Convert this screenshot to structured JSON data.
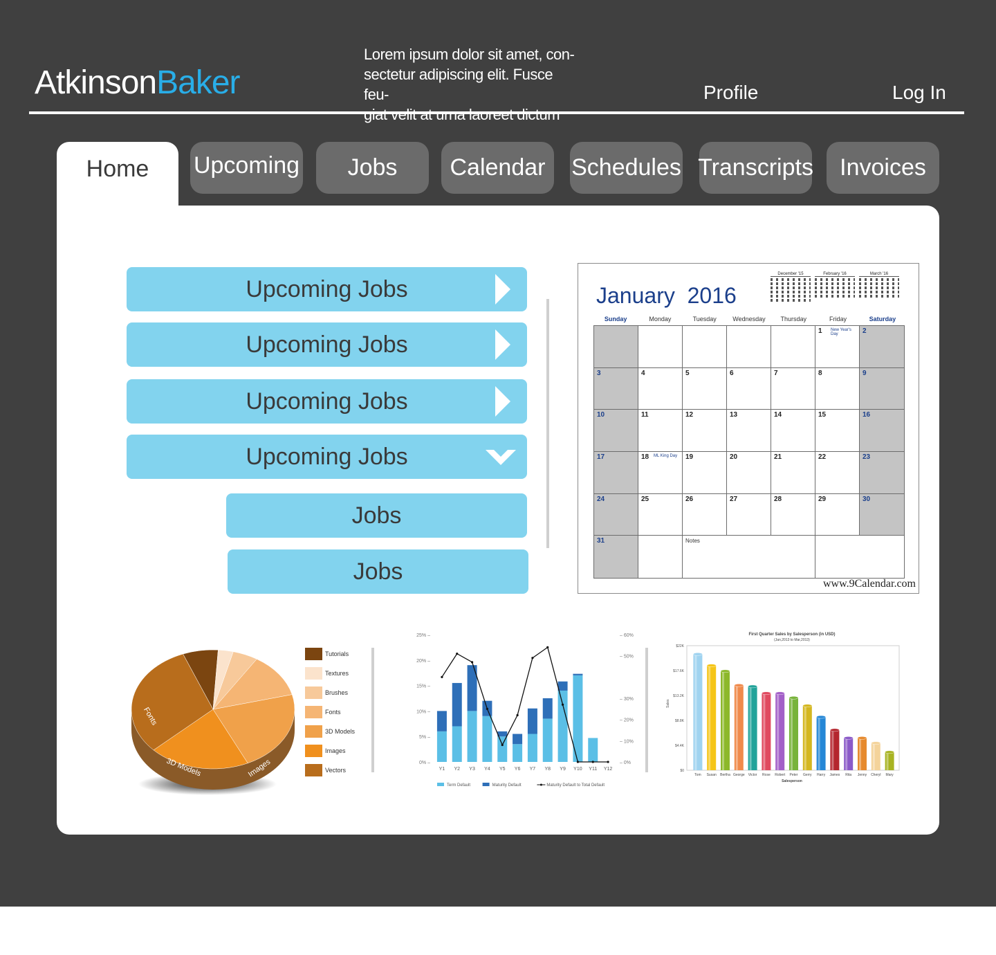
{
  "header": {
    "logo_part1": "Atkinson",
    "logo_part2": "Baker",
    "tagline_line1": "Lorem ipsum dolor sit amet, con-",
    "tagline_line2": "sectetur adipiscing elit. Fusce feu-",
    "tagline_line3": "giat velit at urna laoreet dictum",
    "profile_link": "Profile",
    "login_link": "Log In"
  },
  "tabs": [
    "Home",
    "Upcoming",
    "Jobs",
    "Calendar",
    "Schedules",
    "Transcripts",
    "Invoices"
  ],
  "list": {
    "items": [
      "Upcoming Jobs",
      "Upcoming Jobs",
      "Upcoming Jobs",
      "Upcoming Jobs"
    ],
    "subitems": [
      "Jobs",
      "Jobs"
    ]
  },
  "calendar": {
    "month": "January",
    "year": "2016",
    "mini_months": [
      "December '15",
      "February '16",
      "March '16"
    ],
    "day_names": [
      "Sunday",
      "Monday",
      "Tuesday",
      "Wednesday",
      "Thursday",
      "Friday",
      "Saturday"
    ],
    "holidays": {
      "new_years": "New Year's Day",
      "mlk": "ML King Day"
    },
    "notes_label": "Notes",
    "watermark": "www.9Calendar.com"
  },
  "pie": {
    "legend": [
      "Tutorials",
      "Textures",
      "Brushes",
      "Fonts",
      "3D Models",
      "Images",
      "Vectors"
    ],
    "colors": [
      "#7b4510",
      "#fbe3cc",
      "#f7c99a",
      "#f5b574",
      "#f0a14a",
      "#f0901e",
      "#b86d1c"
    ],
    "values": [
      7,
      3,
      5,
      12,
      22,
      20,
      31
    ],
    "slice_labels": [
      "Fonts",
      "3D Models",
      "Images"
    ]
  },
  "chart_data": [
    {
      "type": "bar",
      "categories": [
        "Y1",
        "Y2",
        "Y3",
        "Y4",
        "Y5",
        "Y6",
        "Y7",
        "Y8",
        "Y9",
        "Y10",
        "Y11",
        "Y12"
      ],
      "series": [
        {
          "name": "Term Default",
          "values": [
            6,
            7,
            10,
            9,
            5,
            3.5,
            5.5,
            8.5,
            14,
            17,
            4.7,
            0
          ]
        },
        {
          "name": "Maturity Default",
          "values": [
            4,
            8.5,
            9,
            3,
            1,
            2,
            5,
            4,
            1.8,
            0.3,
            0,
            0
          ]
        },
        {
          "name": "Maturity Default to Total Default",
          "values": [
            40,
            51,
            47,
            25,
            8,
            22,
            49,
            54,
            27,
            0,
            0,
            0
          ],
          "axis": "right"
        }
      ],
      "ylim": [
        0,
        25
      ],
      "y_ticks": [
        "25%",
        "20%",
        "15%",
        "10%",
        "5%",
        "0%"
      ],
      "y2lim": [
        0,
        60
      ],
      "y2_ticks": [
        "60%",
        "50%",
        "30%",
        "20%",
        "10%",
        "0%"
      ],
      "colors": [
        "#5bbfe6",
        "#2e6fb8",
        "#111111"
      ],
      "legend": "bottom"
    },
    {
      "type": "bar",
      "title": "First Quarter Sales by Salesperson (in USD)",
      "subtitle": "(Jan,2013 to Mar,2013)",
      "xlabel": "Salesperson",
      "ylabel": "Sales",
      "categories": [
        "Tom",
        "Susan",
        "Bertha",
        "George",
        "Victor",
        "Rose",
        "Robert",
        "Peter",
        "Gerry",
        "Harry",
        "James",
        "Rita",
        "Jenny",
        "Cheryl",
        "Mary"
      ],
      "values": [
        20.5,
        18.5,
        17.5,
        15,
        14.8,
        13.6,
        13.6,
        12.8,
        11.4,
        9.4,
        7.1,
        5.7,
        5.7,
        4.8,
        3.2
      ],
      "y_ticks": [
        "$22K",
        "$17.6K",
        "$13.2K",
        "$8.8K",
        "$4.4K",
        "$0"
      ],
      "ylim": [
        0,
        22
      ],
      "colors": [
        "#9fd3f0",
        "#f5c518",
        "#8cb82a",
        "#f08a4b",
        "#22a39a",
        "#e0495f",
        "#a35fc8",
        "#78b33b",
        "#d4b720",
        "#2587d6",
        "#b4262e",
        "#8a5ac8",
        "#e68a2e",
        "#f4d39a",
        "#a8b322"
      ]
    }
  ]
}
